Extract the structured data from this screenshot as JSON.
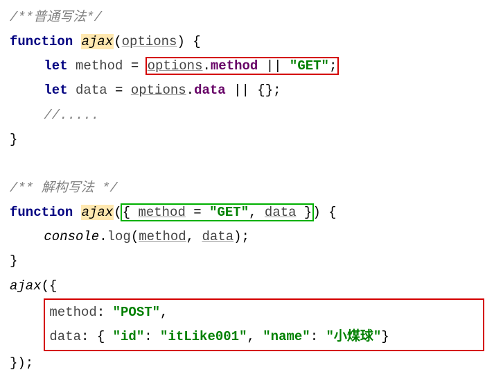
{
  "line1_comment": "/**普通写法*/",
  "fn_kw": "function",
  "fn_name": "ajax",
  "param_options": "options",
  "let_kw": "let",
  "var_method": "method",
  "var_data": "data",
  "eq": " = ",
  "dot": ".",
  "prop_method": "method",
  "prop_data": "data",
  "or": " || ",
  "str_GET": "\"GET\"",
  "semi": ";",
  "empty_obj": "{}",
  "ellipsis_comment": "//.....",
  "line9_comment": "/** 解构写法 */",
  "console": "console",
  "log": "log",
  "str_POST": "\"POST\"",
  "key_method": "method",
  "key_data": "data",
  "key_id": "\"id\"",
  "val_id": "\"itLike001\"",
  "key_name": "\"name\"",
  "val_name": "\"小煤球\"",
  "colon": ": ",
  "comma": ", ",
  "open_paren": "(",
  "close_paren": ")",
  "open_brace": "{",
  "close_brace": "}",
  "open_brace_sp": "{ ",
  "close_brace_sp": " }",
  "close_brace_paren_semi": "});"
}
